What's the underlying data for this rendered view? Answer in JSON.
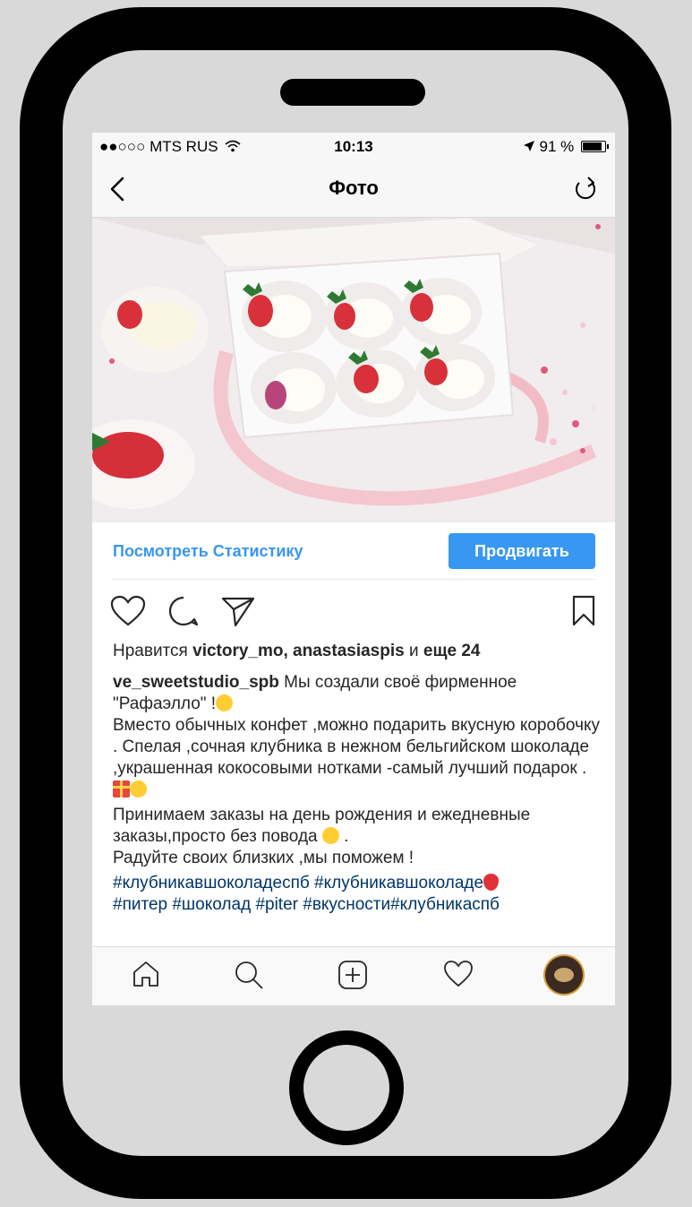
{
  "statusbar": {
    "signal": "●●○○○",
    "carrier": "MTS RUS",
    "wifi_icon": "wifi-icon",
    "time": "10:13",
    "location_icon": "location-arrow-icon",
    "battery": "91 %"
  },
  "navbar": {
    "title": "Фото",
    "back_icon": "chevron-left-icon",
    "refresh_icon": "refresh-icon"
  },
  "promo": {
    "stats_link": "Посмотреть Статистику",
    "promote_button": "Продвигать"
  },
  "actions": {
    "icons": [
      "heart-icon",
      "comment-icon",
      "share-icon",
      "bookmark-icon"
    ]
  },
  "likes": {
    "prefix": "Нравится ",
    "users": "victory_mo, anastasiaspis",
    "and": " и ",
    "more": "еще 24"
  },
  "caption": {
    "username": "ve_sweetstudio_spb",
    "line1": " Мы создали своё фирменное \"Рафаэлло\" !",
    "line2": "Вместо обычных конфет ,можно подарить вкусную коробочку . Спелая ,сочная клубника в нежном бельгийском шоколаде ,украшенная кокосовыми нотками -самый лучший подарок .",
    "line3": "Принимаем  заказы на день рождения и ежедневные заказы,просто без повода ",
    "line3_end": " .",
    "line4": "Радуйте своих близких ,мы поможем !",
    "hashtags1": "#клубникавшоколадеспб #клубникавшоколаде",
    "hashtags2": "#питер #шоколад #piter #вкусности#клубникаспб"
  },
  "bottombar": {
    "tabs": [
      "home-icon",
      "search-icon",
      "add-post-icon",
      "activity-heart-icon",
      "profile-avatar"
    ]
  },
  "colors": {
    "accent": "#3897f0",
    "hashtag": "#003569",
    "phone_frame": "#000000",
    "background": "#d9d9d9"
  }
}
